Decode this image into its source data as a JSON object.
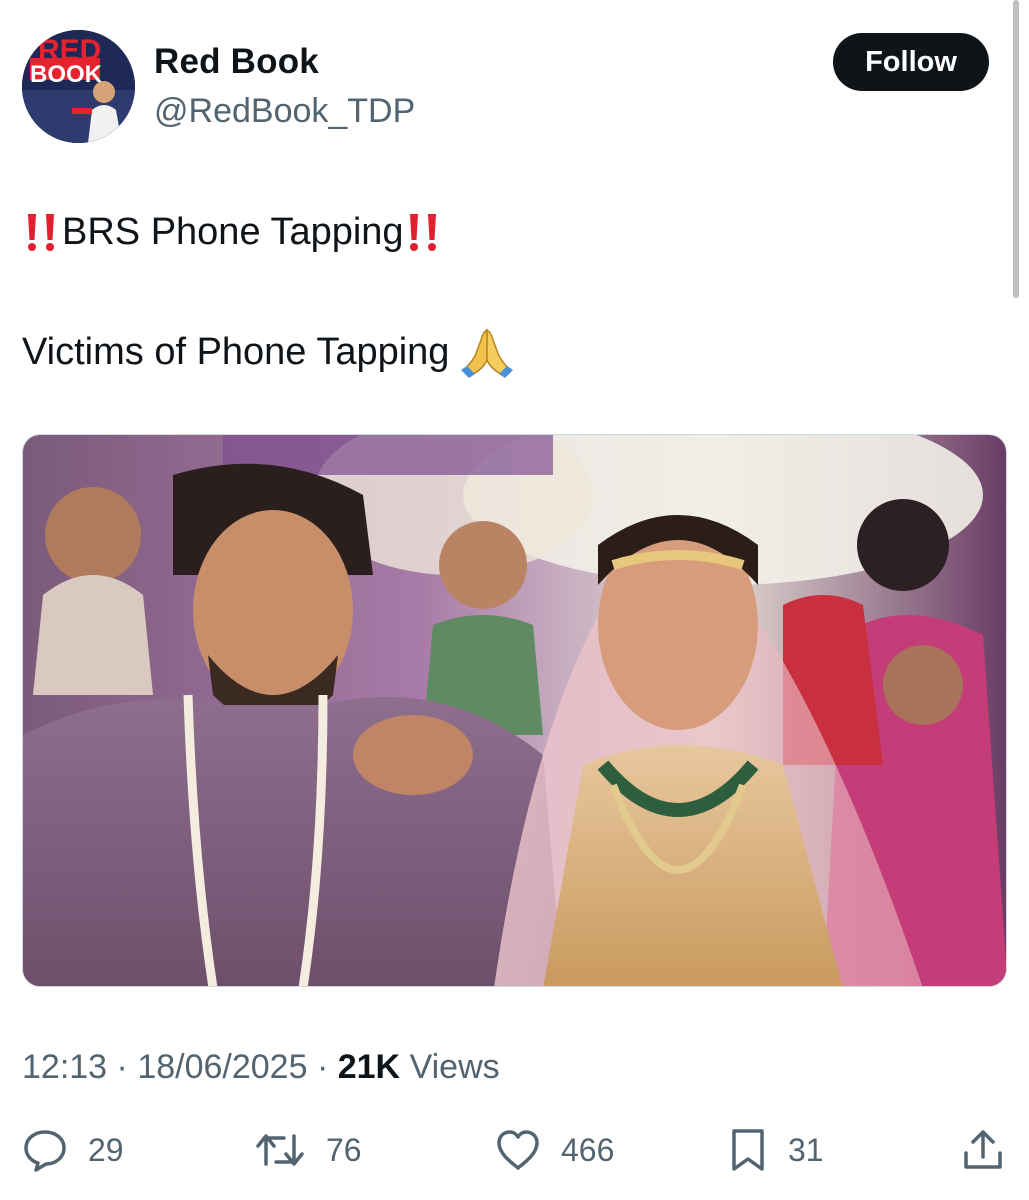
{
  "author": {
    "name": "Red Book",
    "handle": "@RedBook_TDP",
    "avatar_text": "RED BOOK"
  },
  "follow_label": "Follow",
  "post": {
    "line1_text": "BRS Phone Tapping",
    "line2_text": "Victims of Phone Tapping",
    "image_description": "wedding photo of a couple"
  },
  "meta": {
    "time": "12:13",
    "separator": "·",
    "date": "18/06/2025",
    "views_count": "21K",
    "views_label": "Views"
  },
  "actions": {
    "replies": "29",
    "reposts": "76",
    "likes": "466",
    "bookmarks": "31"
  },
  "icons": [
    "reply-icon",
    "repost-icon",
    "like-icon",
    "bookmark-icon",
    "share-icon",
    "double-exclamation-icon",
    "praying-hands-icon"
  ],
  "colors": {
    "text_primary": "#0f1419",
    "text_secondary": "#536471",
    "follow_bg": "#0f1419",
    "emoji_red": "#e0202f"
  }
}
